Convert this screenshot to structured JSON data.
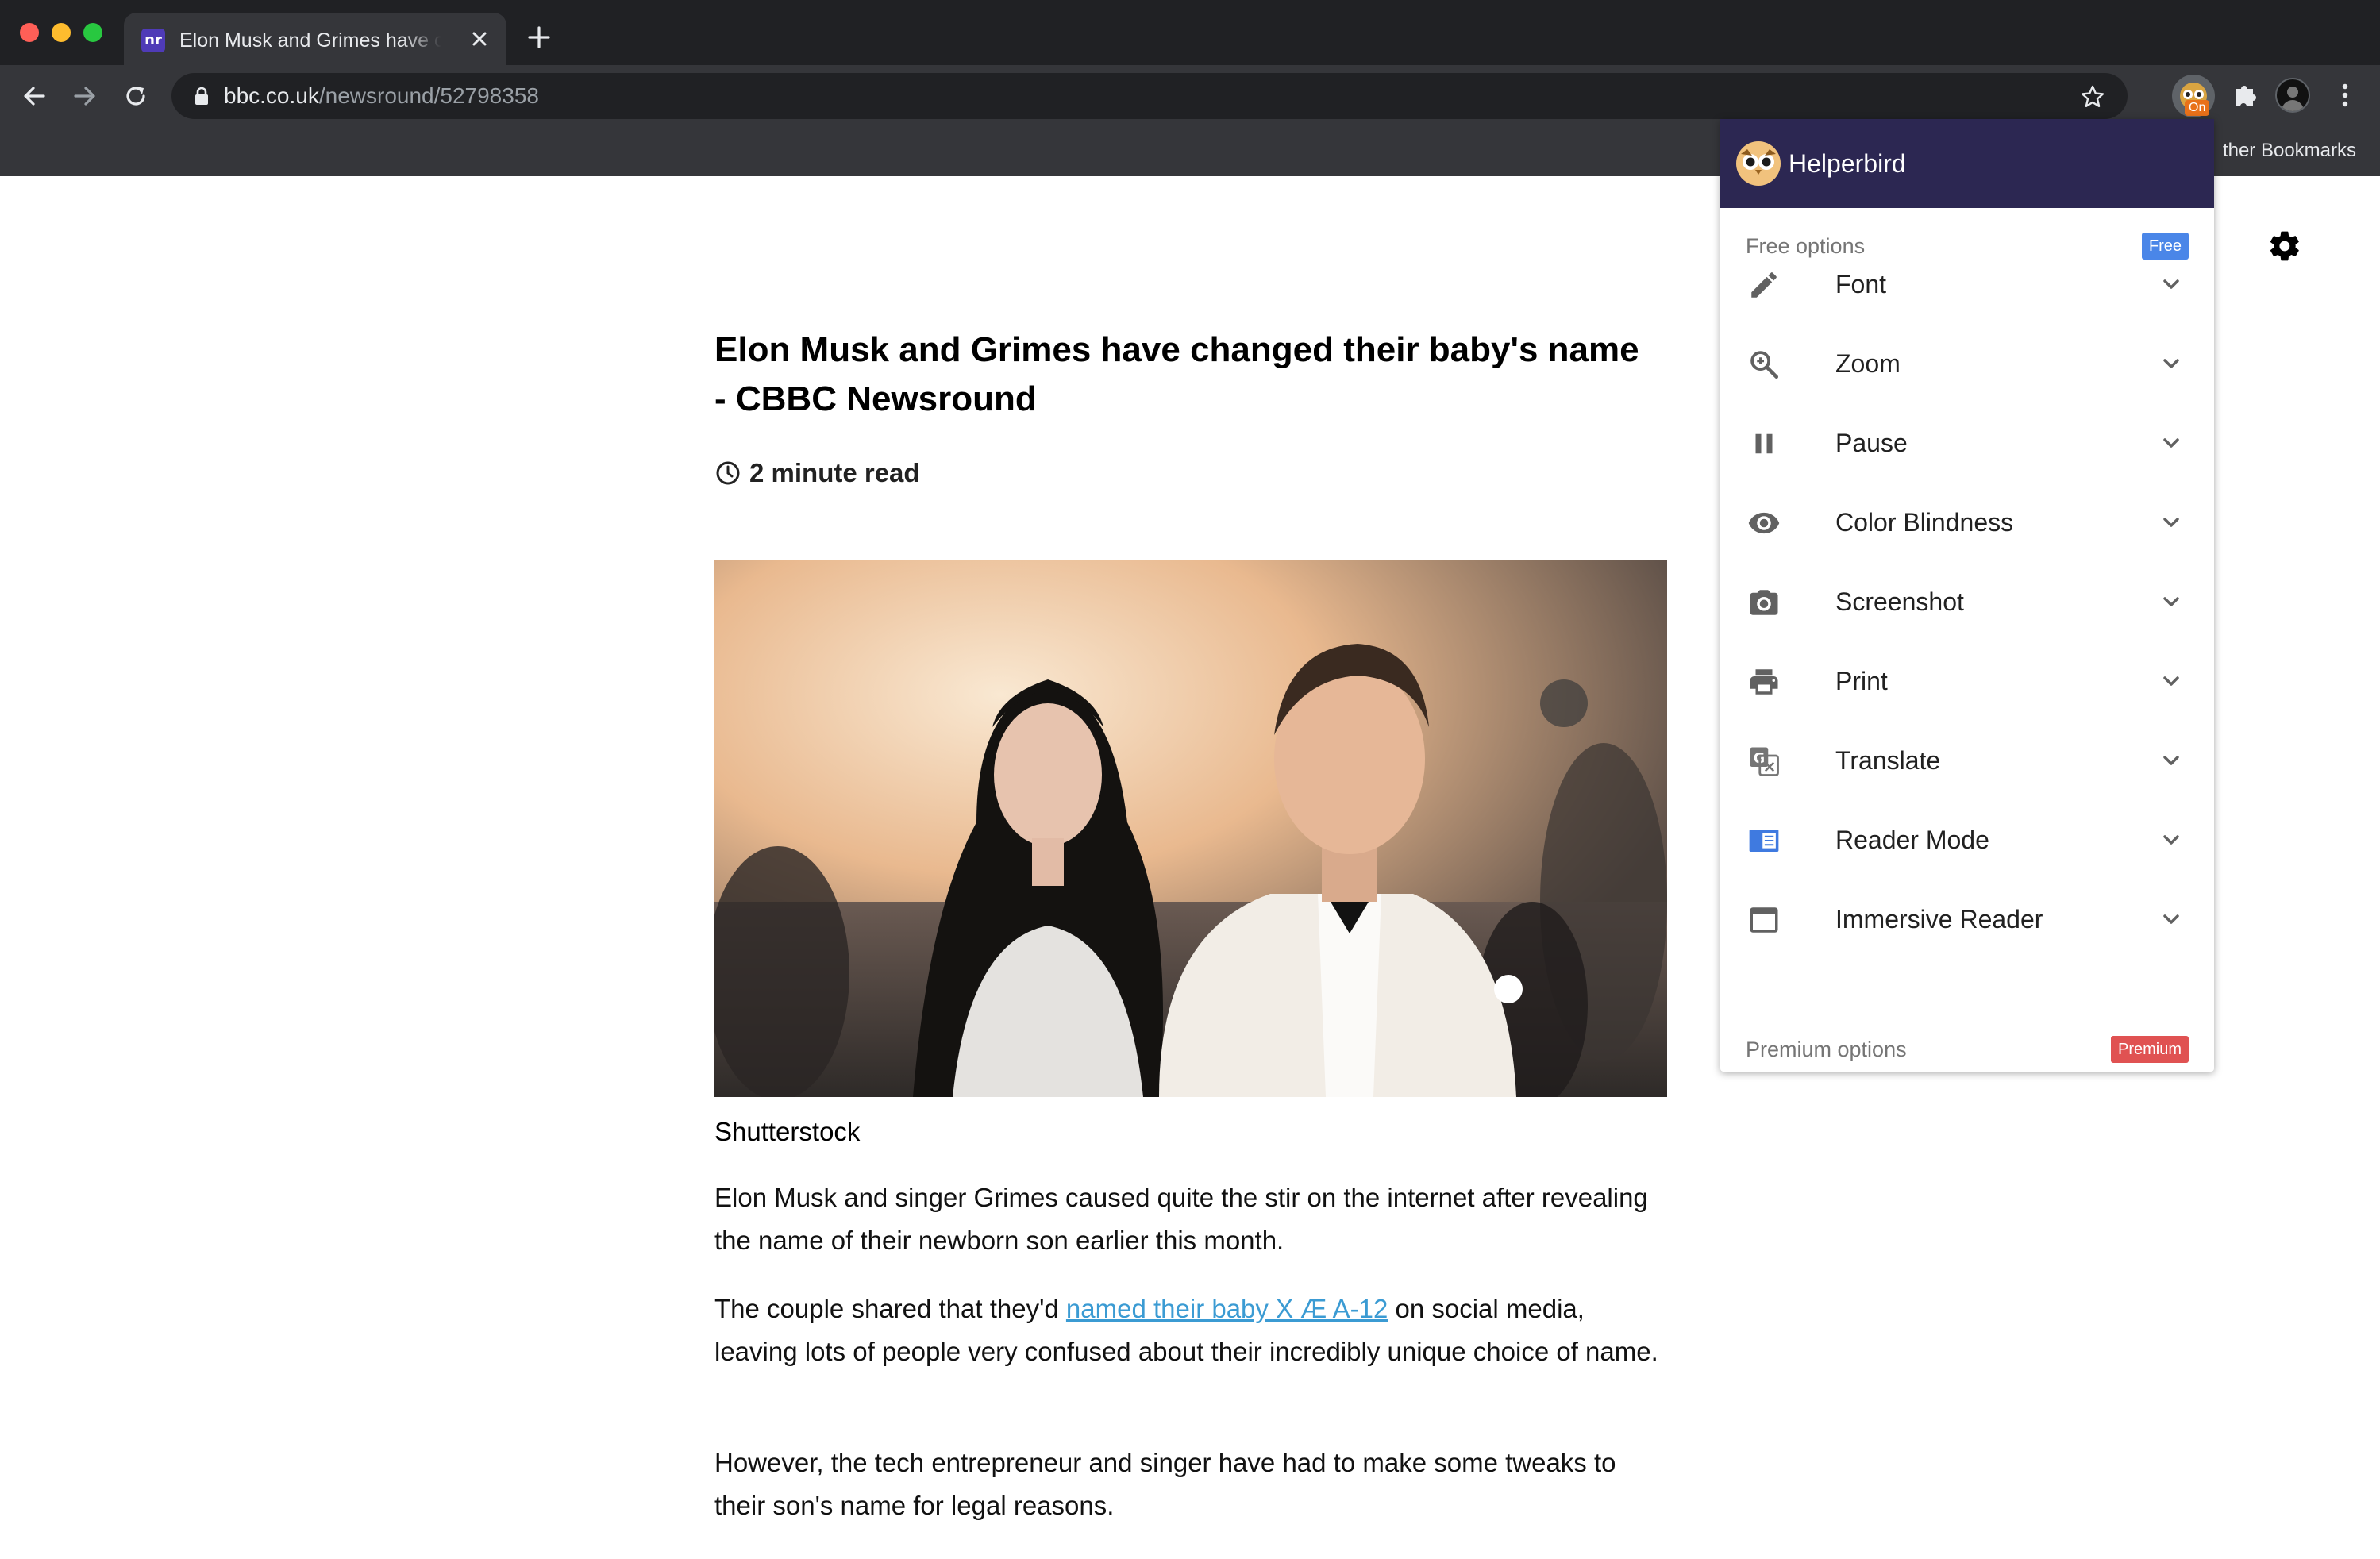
{
  "browser": {
    "tab": {
      "title": "Elon Musk and Grimes have changed their baby's name - CBBC Newsround",
      "favicon_text": "nr"
    },
    "url": {
      "host": "bbc.co.uk",
      "path": "/newsround/52798358"
    },
    "extension_badge": "On",
    "bookmarks": {
      "other_label": "ther Bookmarks"
    }
  },
  "article": {
    "headline": "Elon Musk and Grimes have changed their baby's name - CBBC Newsround",
    "read_time": "2 minute read",
    "image_caption": "Shutterstock",
    "paragraphs": {
      "p1": "Elon Musk and singer Grimes caused quite the stir on the internet after revealing the name of their newborn son earlier this month.",
      "p2_before": "The couple shared that they'd ",
      "p2_link": "named their baby X Æ A-12",
      "p2_after": " on social media, leaving lots of people very confused about their incredibly unique choice of name.",
      "p3": "However, the tech entrepreneur and singer have had to make some tweaks to their son's name for legal reasons."
    },
    "link_color": "#3b9bd3"
  },
  "helperbird": {
    "title": "Helperbird",
    "free_section": "Free options",
    "free_badge": "Free",
    "premium_section": "Premium options",
    "premium_badge": "Premium",
    "header_color": "#2c2752",
    "items": [
      {
        "label": "Font",
        "icon": "pencil-icon"
      },
      {
        "label": "Zoom",
        "icon": "zoom-icon"
      },
      {
        "label": "Pause",
        "icon": "pause-icon"
      },
      {
        "label": "Color Blindness",
        "icon": "eye-icon"
      },
      {
        "label": "Screenshot",
        "icon": "camera-icon"
      },
      {
        "label": "Print",
        "icon": "printer-icon"
      },
      {
        "label": "Translate",
        "icon": "translate-icon"
      },
      {
        "label": "Reader Mode",
        "icon": "reader-mode-icon"
      },
      {
        "label": "Immersive Reader",
        "icon": "window-icon"
      }
    ]
  }
}
